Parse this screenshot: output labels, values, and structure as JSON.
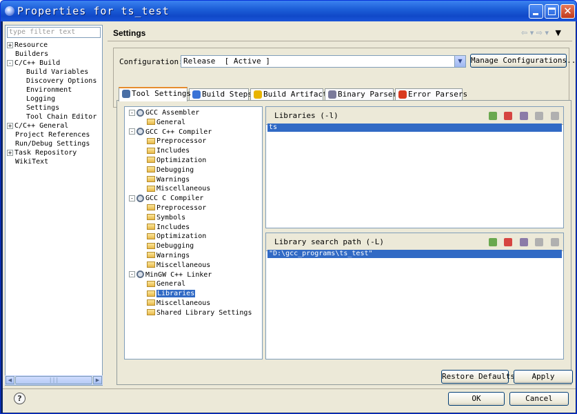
{
  "window": {
    "title": "Properties for ts_test"
  },
  "filter": {
    "placeholder": "type filter text"
  },
  "left_tree": [
    {
      "label": "Resource",
      "level": 0,
      "expander": "+"
    },
    {
      "label": "Builders",
      "level": 0,
      "expander": ""
    },
    {
      "label": "C/C++ Build",
      "level": 0,
      "expander": "-"
    },
    {
      "label": "Build Variables",
      "level": 1,
      "expander": ""
    },
    {
      "label": "Discovery Options",
      "level": 1,
      "expander": ""
    },
    {
      "label": "Environment",
      "level": 1,
      "expander": ""
    },
    {
      "label": "Logging",
      "level": 1,
      "expander": ""
    },
    {
      "label": "Settings",
      "level": 1,
      "expander": ""
    },
    {
      "label": "Tool Chain Editor",
      "level": 1,
      "expander": ""
    },
    {
      "label": "C/C++ General",
      "level": 0,
      "expander": "+"
    },
    {
      "label": "Project References",
      "level": 0,
      "expander": ""
    },
    {
      "label": "Run/Debug Settings",
      "level": 0,
      "expander": ""
    },
    {
      "label": "Task Repository",
      "level": 0,
      "expander": "+"
    },
    {
      "label": "WikiText",
      "level": 0,
      "expander": ""
    }
  ],
  "header": {
    "title": "Settings"
  },
  "configuration": {
    "label": "Configuration:",
    "value": "Release  [ Active ]",
    "manage_label": "Manage Configurations..."
  },
  "tabs": [
    {
      "label": "Tool Settings",
      "active": true,
      "icon_color": "#4a6fa5"
    },
    {
      "label": "Build Steps",
      "active": false,
      "icon_color": "#3a73d6"
    },
    {
      "label": "Build Artifact",
      "active": false,
      "icon_color": "#e8b400"
    },
    {
      "label": "Binary Parsers",
      "active": false,
      "icon_color": "#7a7a9a"
    },
    {
      "label": "Error Parsers",
      "active": false,
      "icon_color": "#d93a1e"
    }
  ],
  "tool_tree": [
    {
      "label": "GCC Assembler",
      "type": "tool",
      "expander": "-"
    },
    {
      "label": "General",
      "type": "option"
    },
    {
      "label": "GCC C++ Compiler",
      "type": "tool",
      "expander": "-"
    },
    {
      "label": "Preprocessor",
      "type": "option"
    },
    {
      "label": "Includes",
      "type": "option"
    },
    {
      "label": "Optimization",
      "type": "option"
    },
    {
      "label": "Debugging",
      "type": "option"
    },
    {
      "label": "Warnings",
      "type": "option"
    },
    {
      "label": "Miscellaneous",
      "type": "option"
    },
    {
      "label": "GCC C Compiler",
      "type": "tool",
      "expander": "-"
    },
    {
      "label": "Preprocessor",
      "type": "option"
    },
    {
      "label": "Symbols",
      "type": "option"
    },
    {
      "label": "Includes",
      "type": "option"
    },
    {
      "label": "Optimization",
      "type": "option"
    },
    {
      "label": "Debugging",
      "type": "option"
    },
    {
      "label": "Warnings",
      "type": "option"
    },
    {
      "label": "Miscellaneous",
      "type": "option"
    },
    {
      "label": "MinGW C++ Linker",
      "type": "tool",
      "expander": "-"
    },
    {
      "label": "General",
      "type": "option"
    },
    {
      "label": "Libraries",
      "type": "option",
      "selected": true
    },
    {
      "label": "Miscellaneous",
      "type": "option"
    },
    {
      "label": "Shared Library Settings",
      "type": "option"
    }
  ],
  "libraries": {
    "header": "Libraries (-l)",
    "items": [
      "ts"
    ]
  },
  "search_path": {
    "header": "Library search path (-L)",
    "items": [
      "\"D:\\gcc_programs\\ts_test\""
    ]
  },
  "buttons": {
    "restore_defaults": "Restore Defaults",
    "apply": "Apply",
    "ok": "OK",
    "cancel": "Cancel",
    "help": "?"
  }
}
